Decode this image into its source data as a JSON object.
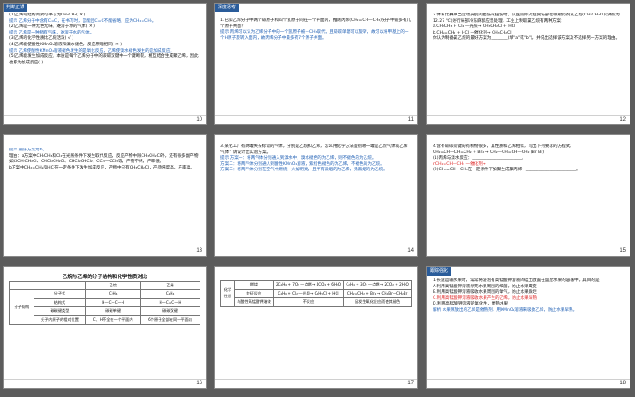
{
  "slides": [
    {
      "num": "10",
      "tag": "判断正误",
      "lines": [
        "(1)乙烯的结构简式可书写为CH₂CH₂( ✕ )",
        "提示  乙烯分子中含有C=C，在书写时，官能团C=C不能省略，应为CH₂=CH₂。",
        "(2)乙烯是一种无色无味，难溶于水的气体( ✕ )",
        "提示  乙烯是一种稍有气味，难溶于水的气体。",
        "(3)乙烯的化学性质比乙烷活泼( √ )",
        "(4)乙烯能使酸性KMnO₄溶液和溴水褪色，反应原理相同( ✕ )",
        "提示  乙烯使酸性KMnO₄溶液褪色发生的是氧化反应，乙烯使溴水褪色发生的是加成反应。",
        "(5)乙烯能发生加成反应，本质是每个乙烯分子中的碳碳双键中一个键断裂，相互结合生成聚乙烯，因此也称为加成反应( )"
      ]
    },
    {
      "num": "11",
      "tag": "深度思考",
      "lines": [
        "1.已知乙烯分子中两个碳原子和四个氢原子同在一个平面内，推测丙烯(CH₂=CH—CH₃)分子中最多有几个原子共面？",
        "提示  丙烯可以认为乙烯分子中的一个氢原子被—CH₃取代，且碳碳单键可以旋转，故可以将甲基上的一个H原子旋转入面内，故丙烯分子中最多有7个原子共面。"
      ]
    },
    {
      "num": "12",
      "tag": "",
      "lines": [
        "2.体育比赛中当运动员肌肉挫伤或扭伤时，队医随即对准受伤部位喷射药剂氯乙烷(CH₃CH₂Cl)(沸点为12.27 ℃)进行局部冷冻麻醉应急处理，工业上制取氯乙烷有两种方案：",
        "a.CH₃CH₃ + Cl₂ —光照→ CH₃CH₂Cl + HCl",
        "b.CH₂=CH₂ + HCl —催化剂→ CH₃CH₂Cl",
        "你认为制备氯乙烷的最好方案为________(填\"a\"或\"b\")，并说出选择该方案及不选择另一方案的理由。"
      ]
    },
    {
      "num": "13",
      "tag": "",
      "lines": [
        "提示  最好方案为b。",
        "理由：a方案中CH₃CH₃和Cl₂在光照条件下发生取代反应，反应产物中除CH₃CH₂Cl外，还有很多副产物如ClCH₂CH₂Cl、CHCl₂CH₂Cl、CHCl₂CHCl₂、CCl₃—CCl₃等，产物不纯，产率低。",
        "b方案中CH₂=CH₂和HCl在一定条件下发生加成反应，产物中只有CH₃CH₂Cl，产品纯度高、产率高。"
      ]
    },
    {
      "num": "14",
      "tag": "",
      "lines": [
        "3.某化工厂有两罐失去标识的气体，分别是乙烷和乙烯，怎么用化学方法鉴别哪一罐是乙烷气体或乙烯气体？请设计出实验方案。",
        "提示  方案一：将两气体分别通入到溴水中，溴水褪色的为乙烯，则不褪色的为乙烷。",
        "方案二：将两气体分别通入到酸性KMnO₄溶液，紫红色褪色的为乙烯，不褪色的为乙烷。",
        "方案三：将两气体分别在空气中燃烧，火焰明亮，且伴有黑烟的为乙烯，无黑烟的为乙烷。"
      ]
    },
    {
      "num": "15",
      "tag": "",
      "lines": [
        "4.含有碳碳双键的有机物很多，其性质和乙烯相似，写出下列要求的方程式。",
        "CH₂=CH—CH=CH₂ + Br₂ → CH₂—CH=CH—CH₂ (Br Br)",
        "(1)丙烯与溴水反应：________________________。",
        "nCH₂=CH—CH₃ —催化剂→",
        "(2)CH₂=CH—CH₃在一定条件下加聚生成聚丙烯：________________________。"
      ]
    },
    {
      "num": "16",
      "banner": "乙烷与乙烯的分子结构和化学性质对比",
      "table": {
        "head": [
          "",
          "",
          "乙烷",
          "乙烯"
        ],
        "rows": [
          [
            "分子结构",
            "分子式",
            "C₂H₆",
            "C₂H₄"
          ],
          [
            "",
            "结构式",
            "H—C—C—H",
            "H—C=C—H"
          ],
          [
            "",
            "碳碳键类型",
            "碳碳单键",
            "碳碳双键"
          ],
          [
            "",
            "分子内原子的相对位置",
            "C、H不全在一个平面内",
            "6个原子全部在同一平面内"
          ]
        ]
      }
    },
    {
      "num": "17",
      "table": {
        "head": [
          "",
          "",
          "",
          ""
        ],
        "rows": [
          [
            "化学性质",
            "燃烧",
            "2C₂H₆ + 7O₂ —点燃→ 4CO₂ + 6H₂O",
            "C₂H₄ + 3O₂ —点燃→ 2CO₂ + 2H₂O"
          ],
          [
            "",
            "特征反应",
            "C₂H₆ + Cl₂ —光照→ C₂H₅Cl + HCl",
            "CH₂=CH₂ + Br₂ → CH₂Br—CH₂Br"
          ],
          [
            "",
            "与酸性高锰酸钾溶液",
            "不反应",
            "因发生氧化反应而使其褪色"
          ]
        ]
      }
    },
    {
      "num": "18",
      "tag": "跟踪强化",
      "lines": [
        "1.长途运输水果时，常常将浸泡有高锰酸钾溶液的硅土放置在盛放水果的容器中，其目的是",
        "A.利用高锰酸钾溶液杀死水果周围的细菌，防止水果霉变",
        "B.利用高锰酸钾溶液吸收水果周围的氧气，防止水果腐烂",
        "C.利用高锰酸钾溶液吸收水果产生的乙烯，防止水果早熟",
        "D.利用高锰酸钾溶液的氧化性，催熟水果",
        "解析  水果释放出的乙烯是催熟剂，用KMnO₄溶液来吸收乙烯，防止水果早熟。"
      ]
    }
  ]
}
